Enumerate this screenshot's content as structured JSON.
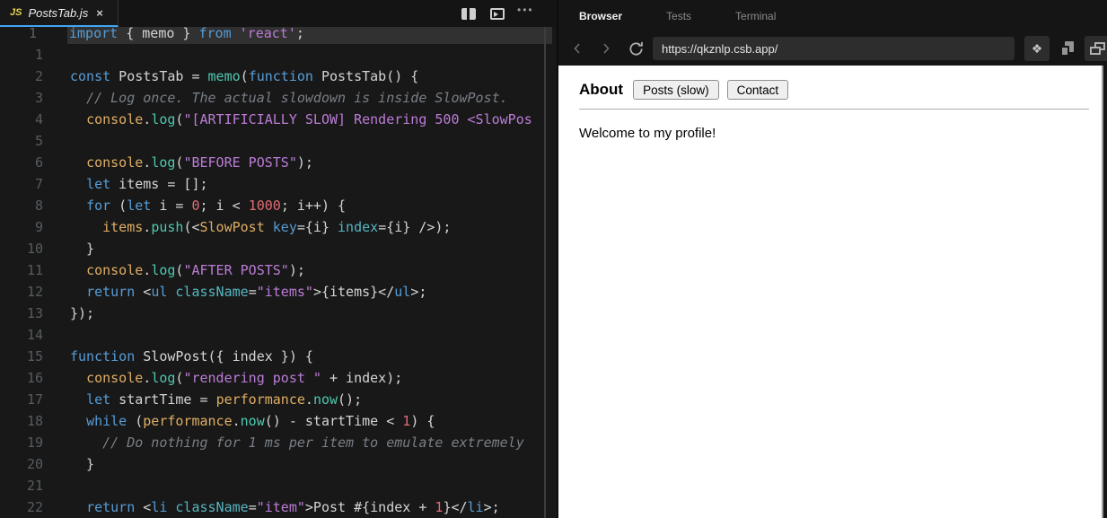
{
  "editor": {
    "tab": {
      "icon_label": "JS",
      "filename": "PostsTab.js",
      "close_label": "×"
    },
    "toolbar": {
      "more_label": "•••"
    },
    "palette": {
      "kw": "#569cd6",
      "fn": "#4ec9b0",
      "obj": "#e0ae64",
      "str": "#bb7cd6",
      "num": "#e06c75",
      "com": "#797f87",
      "attr": "#56b6c2",
      "txt": "#d4d4d4"
    },
    "floating_line": {
      "number": "1",
      "tokens": [
        {
          "t": "import",
          "c": "kw"
        },
        {
          "t": " { memo } ",
          "c": "txt"
        },
        {
          "t": "from",
          "c": "kw"
        },
        {
          "t": " ",
          "c": "txt"
        },
        {
          "t": "'react'",
          "c": "str"
        },
        {
          "t": ";",
          "c": "txt"
        }
      ]
    },
    "lines": [
      {
        "n": "1",
        "tokens": []
      },
      {
        "n": "2",
        "tokens": [
          {
            "t": "const",
            "c": "kw"
          },
          {
            "t": " PostsTab = ",
            "c": "txt"
          },
          {
            "t": "memo",
            "c": "fn"
          },
          {
            "t": "(",
            "c": "txt"
          },
          {
            "t": "function",
            "c": "kw"
          },
          {
            "t": " PostsTab() {",
            "c": "txt"
          }
        ]
      },
      {
        "n": "3",
        "tokens": [
          {
            "t": "  ",
            "c": "txt"
          },
          {
            "t": "// Log once. The actual slowdown is inside SlowPost.",
            "c": "com"
          }
        ]
      },
      {
        "n": "4",
        "tokens": [
          {
            "t": "  ",
            "c": "txt"
          },
          {
            "t": "console",
            "c": "obj"
          },
          {
            "t": ".",
            "c": "txt"
          },
          {
            "t": "log",
            "c": "fn"
          },
          {
            "t": "(",
            "c": "txt"
          },
          {
            "t": "\"[ARTIFICIALLY SLOW] Rendering 500 <SlowPos",
            "c": "str"
          }
        ]
      },
      {
        "n": "5",
        "tokens": []
      },
      {
        "n": "6",
        "tokens": [
          {
            "t": "  ",
            "c": "txt"
          },
          {
            "t": "console",
            "c": "obj"
          },
          {
            "t": ".",
            "c": "txt"
          },
          {
            "t": "log",
            "c": "fn"
          },
          {
            "t": "(",
            "c": "txt"
          },
          {
            "t": "\"BEFORE POSTS\"",
            "c": "str"
          },
          {
            "t": ");",
            "c": "txt"
          }
        ]
      },
      {
        "n": "7",
        "tokens": [
          {
            "t": "  ",
            "c": "txt"
          },
          {
            "t": "let",
            "c": "kw"
          },
          {
            "t": " items = [];",
            "c": "txt"
          }
        ]
      },
      {
        "n": "8",
        "tokens": [
          {
            "t": "  ",
            "c": "txt"
          },
          {
            "t": "for",
            "c": "kw"
          },
          {
            "t": " (",
            "c": "txt"
          },
          {
            "t": "let",
            "c": "kw"
          },
          {
            "t": " i = ",
            "c": "txt"
          },
          {
            "t": "0",
            "c": "num"
          },
          {
            "t": "; i < ",
            "c": "txt"
          },
          {
            "t": "1000",
            "c": "num"
          },
          {
            "t": "; i++) {",
            "c": "txt"
          }
        ]
      },
      {
        "n": "9",
        "tokens": [
          {
            "t": "    ",
            "c": "txt"
          },
          {
            "t": "items",
            "c": "obj"
          },
          {
            "t": ".",
            "c": "txt"
          },
          {
            "t": "push",
            "c": "fn"
          },
          {
            "t": "(<",
            "c": "txt"
          },
          {
            "t": "SlowPost",
            "c": "obj"
          },
          {
            "t": " ",
            "c": "txt"
          },
          {
            "t": "key",
            "c": "kw"
          },
          {
            "t": "={i} ",
            "c": "txt"
          },
          {
            "t": "index",
            "c": "attr"
          },
          {
            "t": "={i} />);",
            "c": "txt"
          }
        ]
      },
      {
        "n": "10",
        "tokens": [
          {
            "t": "  }",
            "c": "txt"
          }
        ]
      },
      {
        "n": "11",
        "tokens": [
          {
            "t": "  ",
            "c": "txt"
          },
          {
            "t": "console",
            "c": "obj"
          },
          {
            "t": ".",
            "c": "txt"
          },
          {
            "t": "log",
            "c": "fn"
          },
          {
            "t": "(",
            "c": "txt"
          },
          {
            "t": "\"AFTER POSTS\"",
            "c": "str"
          },
          {
            "t": ");",
            "c": "txt"
          }
        ]
      },
      {
        "n": "12",
        "tokens": [
          {
            "t": "  ",
            "c": "txt"
          },
          {
            "t": "return",
            "c": "kw"
          },
          {
            "t": " <",
            "c": "txt"
          },
          {
            "t": "ul",
            "c": "kw"
          },
          {
            "t": " ",
            "c": "txt"
          },
          {
            "t": "className",
            "c": "attr"
          },
          {
            "t": "=",
            "c": "txt"
          },
          {
            "t": "\"items\"",
            "c": "str"
          },
          {
            "t": ">{items}</",
            "c": "txt"
          },
          {
            "t": "ul",
            "c": "kw"
          },
          {
            "t": ">;",
            "c": "txt"
          }
        ]
      },
      {
        "n": "13",
        "tokens": [
          {
            "t": "});",
            "c": "txt"
          }
        ]
      },
      {
        "n": "14",
        "tokens": []
      },
      {
        "n": "15",
        "tokens": [
          {
            "t": "function",
            "c": "kw"
          },
          {
            "t": " SlowPost({ index }) {",
            "c": "txt"
          }
        ]
      },
      {
        "n": "16",
        "tokens": [
          {
            "t": "  ",
            "c": "txt"
          },
          {
            "t": "console",
            "c": "obj"
          },
          {
            "t": ".",
            "c": "txt"
          },
          {
            "t": "log",
            "c": "fn"
          },
          {
            "t": "(",
            "c": "txt"
          },
          {
            "t": "\"rendering post \"",
            "c": "str"
          },
          {
            "t": " + index);",
            "c": "txt"
          }
        ]
      },
      {
        "n": "17",
        "tokens": [
          {
            "t": "  ",
            "c": "txt"
          },
          {
            "t": "let",
            "c": "kw"
          },
          {
            "t": " startTime = ",
            "c": "txt"
          },
          {
            "t": "performance",
            "c": "obj"
          },
          {
            "t": ".",
            "c": "txt"
          },
          {
            "t": "now",
            "c": "fn"
          },
          {
            "t": "();",
            "c": "txt"
          }
        ]
      },
      {
        "n": "18",
        "tokens": [
          {
            "t": "  ",
            "c": "txt"
          },
          {
            "t": "while",
            "c": "kw"
          },
          {
            "t": " (",
            "c": "txt"
          },
          {
            "t": "performance",
            "c": "obj"
          },
          {
            "t": ".",
            "c": "txt"
          },
          {
            "t": "now",
            "c": "fn"
          },
          {
            "t": "() - startTime < ",
            "c": "txt"
          },
          {
            "t": "1",
            "c": "num"
          },
          {
            "t": ") {",
            "c": "txt"
          }
        ]
      },
      {
        "n": "19",
        "tokens": [
          {
            "t": "    ",
            "c": "txt"
          },
          {
            "t": "// Do nothing for 1 ms per item to emulate extremely",
            "c": "com"
          }
        ]
      },
      {
        "n": "20",
        "tokens": [
          {
            "t": "  }",
            "c": "txt"
          }
        ]
      },
      {
        "n": "21",
        "tokens": []
      },
      {
        "n": "22",
        "tokens": [
          {
            "t": "  ",
            "c": "txt"
          },
          {
            "t": "return",
            "c": "kw"
          },
          {
            "t": " <",
            "c": "txt"
          },
          {
            "t": "li",
            "c": "kw"
          },
          {
            "t": " ",
            "c": "txt"
          },
          {
            "t": "className",
            "c": "attr"
          },
          {
            "t": "=",
            "c": "txt"
          },
          {
            "t": "\"item\"",
            "c": "str"
          },
          {
            "t": ">Post #{index + ",
            "c": "txt"
          },
          {
            "t": "1",
            "c": "num"
          },
          {
            "t": "}</",
            "c": "txt"
          },
          {
            "t": "li",
            "c": "kw"
          },
          {
            "t": ">;",
            "c": "txt"
          }
        ]
      }
    ]
  },
  "devtools": {
    "tabs": [
      {
        "label": "Browser",
        "active": true
      },
      {
        "label": "Tests",
        "active": false
      },
      {
        "label": "Terminal",
        "active": false
      }
    ],
    "url": "https://qkznlp.csb.app/"
  },
  "page": {
    "nav_title": "About",
    "buttons": [
      "Posts (slow)",
      "Contact"
    ],
    "welcome": "Welcome to my profile!"
  }
}
